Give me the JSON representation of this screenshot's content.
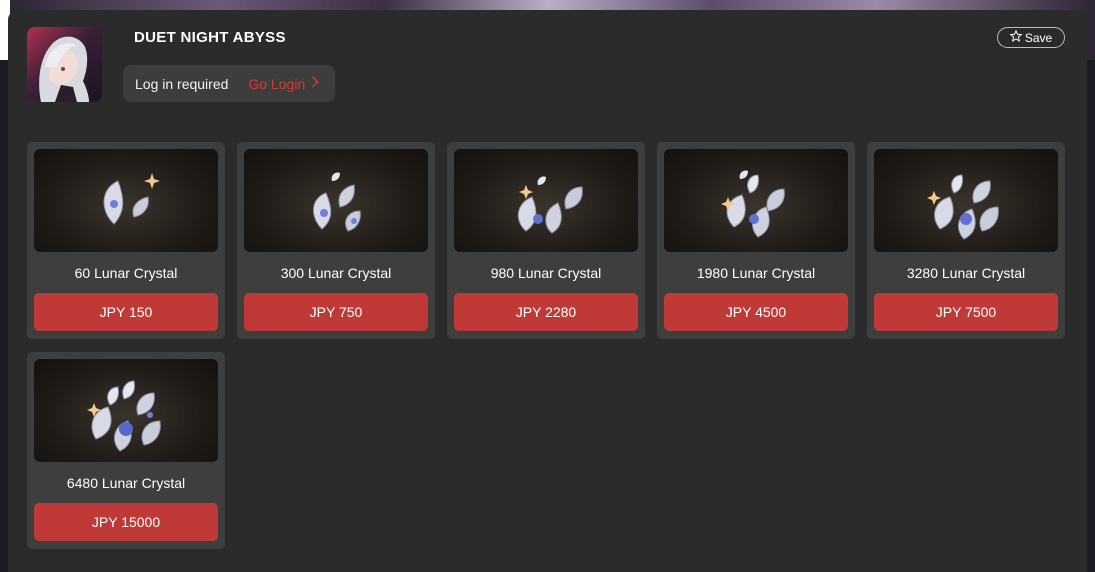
{
  "game": {
    "title": "DUET NIGHT ABYSS",
    "icon": "character-portrait-icon"
  },
  "login": {
    "message": "Log in required",
    "link_label": "Go Login",
    "link_color": "#d83a34"
  },
  "save": {
    "label": "Save",
    "icon": "star-outline-icon"
  },
  "colors": {
    "panel": "#2b2b2b",
    "card": "#3e3e3e",
    "price_button": "#bf3a37"
  },
  "products": [
    {
      "name": "60 Lunar Crystal",
      "price": "JPY 150",
      "icon": "lunar-crystal-icon"
    },
    {
      "name": "300 Lunar Crystal",
      "price": "JPY 750",
      "icon": "lunar-crystal-icon"
    },
    {
      "name": "980 Lunar Crystal",
      "price": "JPY 2280",
      "icon": "lunar-crystal-icon"
    },
    {
      "name": "1980 Lunar Crystal",
      "price": "JPY 4500",
      "icon": "lunar-crystal-icon"
    },
    {
      "name": "3280 Lunar Crystal",
      "price": "JPY 7500",
      "icon": "lunar-crystal-icon"
    },
    {
      "name": "6480 Lunar Crystal",
      "price": "JPY 15000",
      "icon": "lunar-crystal-icon"
    }
  ]
}
